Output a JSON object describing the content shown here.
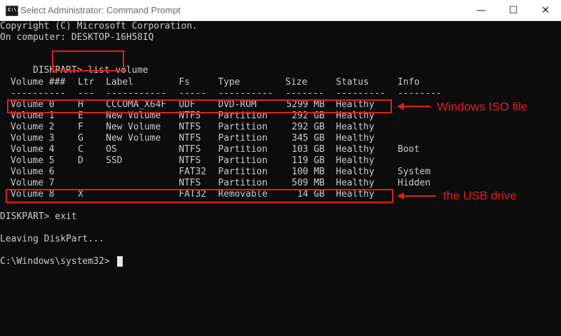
{
  "titlebar": {
    "title": "Select Administrator: Command Prompt",
    "icon": "cmd-icon",
    "icon_text": "C:\\.",
    "min": "—",
    "max": "☐",
    "close": "✕"
  },
  "console": {
    "copyright": "Copyright (C) Microsoft Corporation.",
    "computer": "On computer: DESKTOP-16H58IQ",
    "prompt1": "DISKPART>",
    "command1": "list volume",
    "headers": [
      "Volume ###",
      "Ltr",
      "Label",
      "Fs",
      "Type",
      "Size",
      "Status",
      "Info"
    ],
    "separator": [
      "----------",
      "---",
      "-----------",
      "-----",
      "----------",
      "-------",
      "---------",
      "--------"
    ],
    "rows": [
      {
        "vol": "Volume 0",
        "ltr": "H",
        "label": "CCCOMA_X64F",
        "fs": "UDF",
        "type": "DVD-ROM",
        "size": "5299 MB",
        "status": "Healthy",
        "info": ""
      },
      {
        "vol": "Volume 1",
        "ltr": "E",
        "label": "New Volume",
        "fs": "NTFS",
        "type": "Partition",
        "size": "292 GB",
        "status": "Healthy",
        "info": ""
      },
      {
        "vol": "Volume 2",
        "ltr": "F",
        "label": "New Volume",
        "fs": "NTFS",
        "type": "Partition",
        "size": "292 GB",
        "status": "Healthy",
        "info": ""
      },
      {
        "vol": "Volume 3",
        "ltr": "G",
        "label": "New Volume",
        "fs": "NTFS",
        "type": "Partition",
        "size": "345 GB",
        "status": "Healthy",
        "info": ""
      },
      {
        "vol": "Volume 4",
        "ltr": "C",
        "label": "OS",
        "fs": "NTFS",
        "type": "Partition",
        "size": "103 GB",
        "status": "Healthy",
        "info": "Boot"
      },
      {
        "vol": "Volume 5",
        "ltr": "D",
        "label": "SSD",
        "fs": "NTFS",
        "type": "Partition",
        "size": "119 GB",
        "status": "Healthy",
        "info": ""
      },
      {
        "vol": "Volume 6",
        "ltr": "",
        "label": "",
        "fs": "FAT32",
        "type": "Partition",
        "size": "100 MB",
        "status": "Healthy",
        "info": "System"
      },
      {
        "vol": "Volume 7",
        "ltr": "",
        "label": "",
        "fs": "NTFS",
        "type": "Partition",
        "size": "509 MB",
        "status": "Healthy",
        "info": "Hidden"
      },
      {
        "vol": "Volume 8",
        "ltr": "X",
        "label": "",
        "fs": "FAT32",
        "type": "Removable",
        "size": "14 GB",
        "status": "Healthy",
        "info": ""
      }
    ],
    "prompt2": "DISKPART> exit",
    "leaving": "Leaving DiskPart...",
    "prompt3": "C:\\Windows\\system32>"
  },
  "annotations": {
    "iso": "Windows ISO  file",
    "usb": "the  USB drive",
    "color": "#e02020"
  }
}
